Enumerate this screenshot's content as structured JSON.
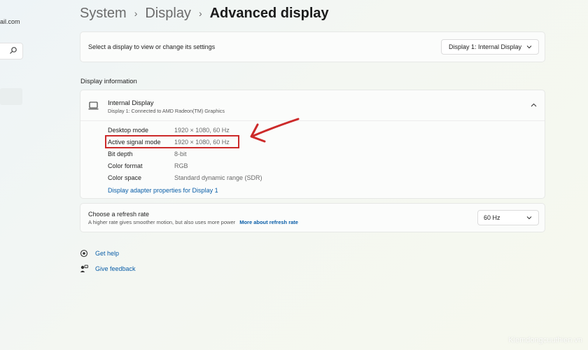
{
  "sidebar": {
    "email_fragment": "ail.com",
    "search_icon": "search-icon"
  },
  "breadcrumb": {
    "items": [
      "System",
      "Display"
    ],
    "separator": "›",
    "current": "Advanced display"
  },
  "select_display": {
    "label": "Select a display to view or change its settings",
    "value": "Display 1: Internal Display"
  },
  "display_info": {
    "section_title": "Display information",
    "name": "Internal Display",
    "subtitle": "Display 1: Connected to AMD Radeon(TM) Graphics",
    "properties": [
      {
        "label": "Desktop mode",
        "value": "1920 × 1080, 60 Hz"
      },
      {
        "label": "Active signal mode",
        "value": "1920 × 1080, 60 Hz"
      },
      {
        "label": "Bit depth",
        "value": "8-bit"
      },
      {
        "label": "Color format",
        "value": "RGB"
      },
      {
        "label": "Color space",
        "value": "Standard dynamic range (SDR)"
      }
    ],
    "adapter_link": "Display adapter properties for Display 1"
  },
  "refresh_rate": {
    "title": "Choose a refresh rate",
    "description": "A higher rate gives smoother motion, but also uses more power",
    "link": "More about refresh rate",
    "value": "60 Hz"
  },
  "help": {
    "get_help": "Get help",
    "give_feedback": "Give feedback"
  },
  "annotation": {
    "color": "#cc2a2a"
  },
  "watermark": "Kiemdongcuuthien.vn",
  "colors": {
    "link": "#0a5ea8",
    "annotation_red": "#cc2a2a"
  }
}
